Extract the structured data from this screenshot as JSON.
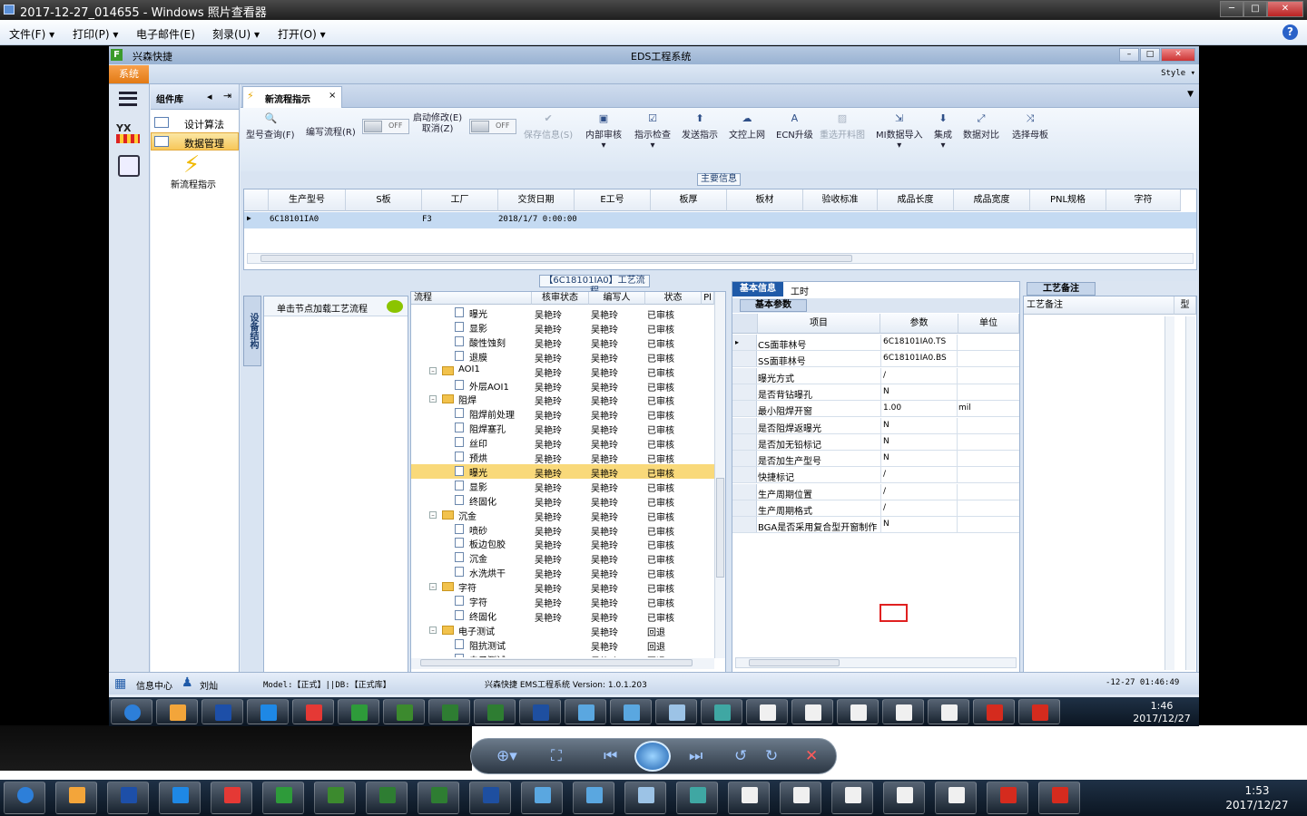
{
  "viewer": {
    "title": "2017-12-27_014655 - Windows 照片查看器",
    "menu": [
      "文件(F)",
      "打印(P)",
      "电子邮件(E)",
      "刻录(U)",
      "打开(O)"
    ],
    "help": "?"
  },
  "app": {
    "left_title": "兴森快捷",
    "center_title": "EDS工程系统",
    "sys_tab": "系统",
    "style": "Style",
    "component_panel": "组件库",
    "components": [
      "设计算法",
      "数据管理"
    ],
    "new_flow": "新流程指示",
    "rail_label": "YX",
    "doc_tab": "新流程指示",
    "toolbar": {
      "model_query": "型号查询(F)",
      "edit_flow": "编写流程(R)",
      "toggle1": "OFF",
      "auto_modify1": "启动修改(E)",
      "auto_modify2": "取消(Z)",
      "toggle2": "OFF",
      "save": "保存信息(S)",
      "internal_review": "内部审核",
      "check": "指示检查",
      "send": "发送指示",
      "upload": "文控上网",
      "ecn": "ECN升级",
      "redo_chart": "重选开料图",
      "mi_import": "MI数据导入",
      "integrate": "集成",
      "compare": "数据对比",
      "select_board": "选择母板"
    },
    "main_info": "主要信息",
    "grid": {
      "headers": [
        "生产型号",
        "S板",
        "工厂",
        "交货日期",
        "E工号",
        "板厚",
        "板材",
        "验收标准",
        "成品长度",
        "成品宽度",
        "PNL规格",
        "字符"
      ],
      "row": {
        "model": "6C18101IA0",
        "factory": "F3",
        "date": "2018/1/7 0:00:00"
      }
    },
    "flow_title": "【6C18101IA0】工艺流程",
    "vtab": "设备结构",
    "load_hint": "单击节点加载工艺流程",
    "tree": {
      "headers": [
        "流程",
        "核审状态",
        "编写人",
        "状态",
        "Pl"
      ],
      "rows": [
        {
          "name": "曝光",
          "type": "leaf",
          "indent": 1,
          "reviewer": "吴艳玲",
          "writer": "吴艳玲",
          "status": "已审核"
        },
        {
          "name": "显影",
          "type": "leaf",
          "indent": 1,
          "reviewer": "吴艳玲",
          "writer": "吴艳玲",
          "status": "已审核"
        },
        {
          "name": "酸性蚀刻",
          "type": "leaf",
          "indent": 1,
          "reviewer": "吴艳玲",
          "writer": "吴艳玲",
          "status": "已审核"
        },
        {
          "name": "退膜",
          "type": "leaf",
          "indent": 1,
          "reviewer": "吴艳玲",
          "writer": "吴艳玲",
          "status": "已审核"
        },
        {
          "name": "AOI1",
          "type": "folder",
          "indent": 0,
          "reviewer": "吴艳玲",
          "writer": "吴艳玲",
          "status": "已审核"
        },
        {
          "name": "外层AOI1",
          "type": "leaf",
          "indent": 1,
          "reviewer": "吴艳玲",
          "writer": "吴艳玲",
          "status": "已审核"
        },
        {
          "name": "阻焊",
          "type": "folder",
          "indent": 0,
          "reviewer": "吴艳玲",
          "writer": "吴艳玲",
          "status": "已审核"
        },
        {
          "name": "阻焊前处理",
          "type": "leaf",
          "indent": 1,
          "reviewer": "吴艳玲",
          "writer": "吴艳玲",
          "status": "已审核"
        },
        {
          "name": "阻焊塞孔",
          "type": "leaf",
          "indent": 1,
          "reviewer": "吴艳玲",
          "writer": "吴艳玲",
          "status": "已审核"
        },
        {
          "name": "丝印",
          "type": "leaf",
          "indent": 1,
          "reviewer": "吴艳玲",
          "writer": "吴艳玲",
          "status": "已审核"
        },
        {
          "name": "预烘",
          "type": "leaf",
          "indent": 1,
          "reviewer": "吴艳玲",
          "writer": "吴艳玲",
          "status": "已审核"
        },
        {
          "name": "曝光",
          "type": "leaf",
          "indent": 1,
          "reviewer": "吴艳玲",
          "writer": "吴艳玲",
          "status": "已审核",
          "selected": true
        },
        {
          "name": "显影",
          "type": "leaf",
          "indent": 1,
          "reviewer": "吴艳玲",
          "writer": "吴艳玲",
          "status": "已审核"
        },
        {
          "name": "终固化",
          "type": "leaf",
          "indent": 1,
          "reviewer": "吴艳玲",
          "writer": "吴艳玲",
          "status": "已审核"
        },
        {
          "name": "沉金",
          "type": "folder",
          "indent": 0,
          "reviewer": "吴艳玲",
          "writer": "吴艳玲",
          "status": "已审核"
        },
        {
          "name": "喷砂",
          "type": "leaf",
          "indent": 1,
          "reviewer": "吴艳玲",
          "writer": "吴艳玲",
          "status": "已审核"
        },
        {
          "name": "板边包胶",
          "type": "leaf",
          "indent": 1,
          "reviewer": "吴艳玲",
          "writer": "吴艳玲",
          "status": "已审核"
        },
        {
          "name": "沉金",
          "type": "leaf",
          "indent": 1,
          "reviewer": "吴艳玲",
          "writer": "吴艳玲",
          "status": "已审核"
        },
        {
          "name": "水洗烘干",
          "type": "leaf",
          "indent": 1,
          "reviewer": "吴艳玲",
          "writer": "吴艳玲",
          "status": "已审核"
        },
        {
          "name": "字符",
          "type": "folder",
          "indent": 0,
          "reviewer": "吴艳玲",
          "writer": "吴艳玲",
          "status": "已审核"
        },
        {
          "name": "字符",
          "type": "leaf",
          "indent": 1,
          "reviewer": "吴艳玲",
          "writer": "吴艳玲",
          "status": "已审核"
        },
        {
          "name": "终固化",
          "type": "leaf",
          "indent": 1,
          "reviewer": "吴艳玲",
          "writer": "吴艳玲",
          "status": "已审核"
        },
        {
          "name": "电子测试",
          "type": "folder",
          "indent": 0,
          "reviewer": "",
          "writer": "吴艳玲",
          "status": "回退"
        },
        {
          "name": "阻抗测试",
          "type": "leaf",
          "indent": 1,
          "reviewer": "",
          "writer": "吴艳玲",
          "status": "回退"
        },
        {
          "name": "电子测试",
          "type": "leaf",
          "indent": 1,
          "reviewer": "",
          "writer": "吴艳玲",
          "status": "回退"
        }
      ]
    },
    "props_tabs": [
      "基本信息",
      "工时"
    ],
    "basic_params": "基本参数",
    "props": {
      "headers": [
        "项目",
        "参数",
        "单位"
      ],
      "rows": [
        {
          "item": "CS面菲林号",
          "value": "6C18101IA0.TS",
          "unit": ""
        },
        {
          "item": "SS面菲林号",
          "value": "6C18101IA0.BS",
          "unit": ""
        },
        {
          "item": "曝光方式",
          "value": "/",
          "unit": ""
        },
        {
          "item": "是否背钻曝孔",
          "value": "N",
          "unit": ""
        },
        {
          "item": "最小阻焊开窗",
          "value": "1.00",
          "unit": "mil"
        },
        {
          "item": "是否阻焊返曝光",
          "value": "N",
          "unit": ""
        },
        {
          "item": "是否加无铅标记",
          "value": "N",
          "unit": ""
        },
        {
          "item": "是否加生产型号",
          "value": "N",
          "unit": ""
        },
        {
          "item": "快捷标记",
          "value": "/",
          "unit": ""
        },
        {
          "item": "生产周期位置",
          "value": "/",
          "unit": ""
        },
        {
          "item": "生产周期格式",
          "value": "/",
          "unit": ""
        },
        {
          "item": "BGA是否采用复合型开窗制作",
          "value": "N",
          "unit": ""
        }
      ]
    },
    "notes_title": "工艺备注",
    "notes_header": "工艺备注",
    "notes_col": "型",
    "status": {
      "info": "信息中心",
      "user": "刘灿",
      "model": "Model:【正式】||DB:【正式库】",
      "system": "兴森快捷 EMS工程系统 Version: 1.0.1.203",
      "time": "-12-27 01:46:49"
    },
    "inner_clock": {
      "time": "1:46",
      "date": "2017/12/27"
    }
  },
  "outer_clock": {
    "time": "1:53",
    "date": "2017/12/27"
  },
  "task_icons": [
    "start",
    "chrome-shell",
    "save",
    "ie",
    "g",
    "f",
    "p",
    "excel",
    "excel",
    "word",
    "photo",
    "photo",
    "doc",
    "shell",
    "x",
    "x",
    "x",
    "x",
    "x",
    "pdf",
    "pdf"
  ]
}
